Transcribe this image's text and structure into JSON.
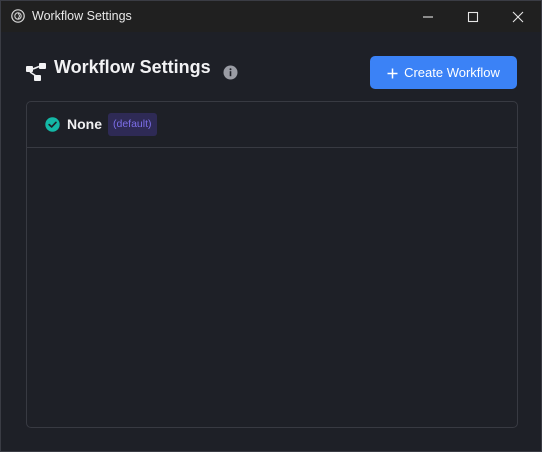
{
  "window": {
    "title": "Workflow Settings",
    "icons": {
      "app": "app-logo-icon",
      "minimize": "minimize-icon",
      "maximize": "maximize-icon",
      "close": "close-icon"
    }
  },
  "header": {
    "title": "Workflow Settings",
    "icon": "workflow-icon",
    "info_icon": "info-icon",
    "create_button_label": "Create Workflow",
    "create_button_icon": "plus-icon"
  },
  "workflows": {
    "items": [
      {
        "label": "None",
        "badge": "(default)",
        "selected": true,
        "icon": "check-circle-icon"
      }
    ]
  },
  "colors": {
    "background": "#1e2027",
    "accent": "#3b82f6",
    "selected_check": "#14b8a6",
    "badge_bg": "#2e2a55",
    "badge_text": "#7c6ee8"
  }
}
